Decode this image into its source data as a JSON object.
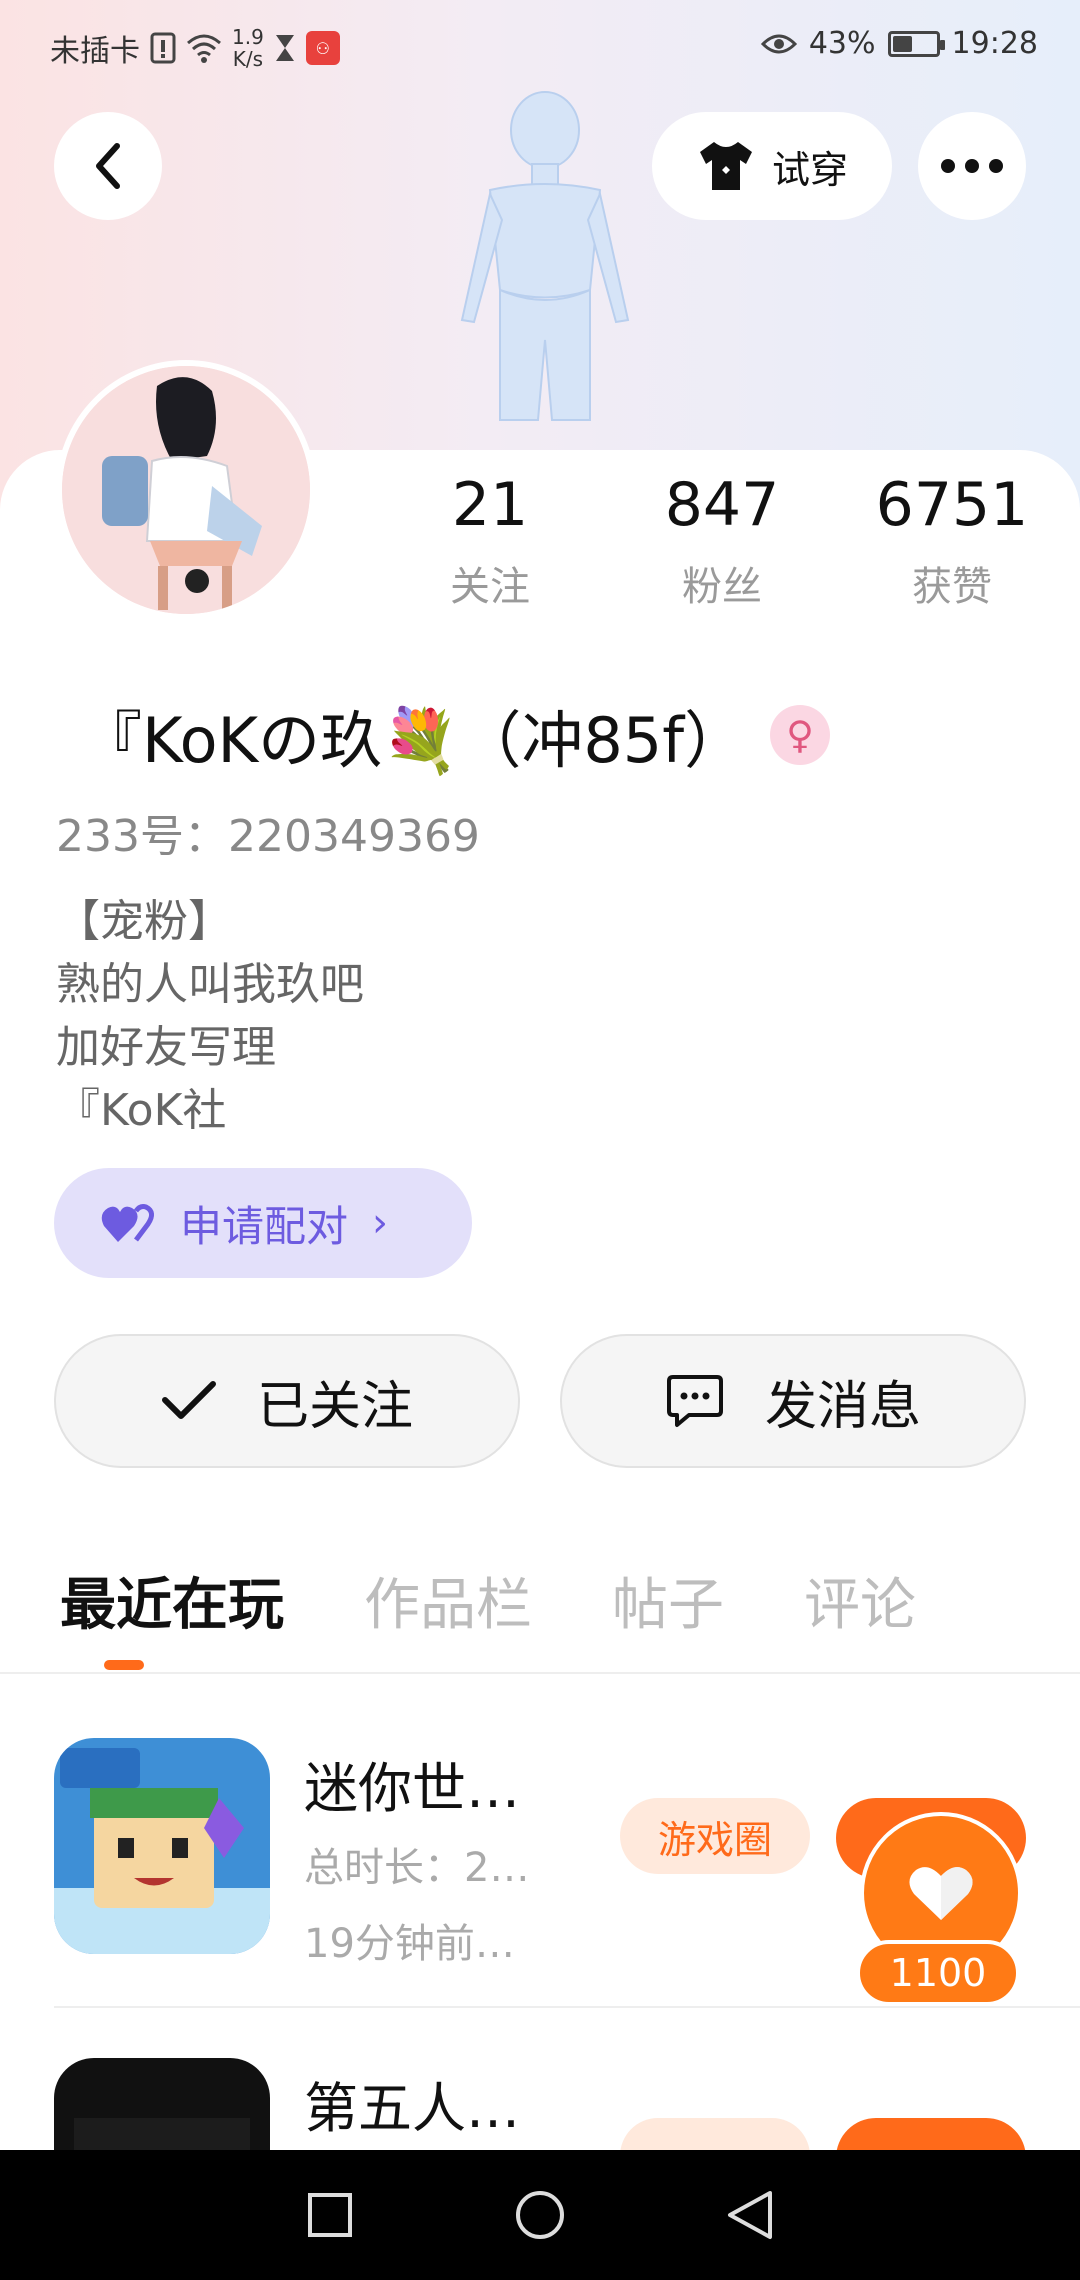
{
  "status_bar": {
    "carrier": "未插卡",
    "speed_value": "1.9",
    "speed_unit": "K/s",
    "battery_percent": "43%",
    "time": "19:28",
    "battery_level": 0.43
  },
  "header": {
    "tryon_label": "试穿"
  },
  "stats": [
    {
      "value": "21",
      "label": "关注"
    },
    {
      "value": "847",
      "label": "粉丝"
    },
    {
      "value": "6751",
      "label": "获赞"
    }
  ],
  "profile": {
    "name": "『KoKの玖💐（冲85f）",
    "gender_symbol": "♀",
    "uid": "233号：220349369",
    "bio": [
      "【宠粉】",
      "熟的人叫我玖吧",
      "加好友写理",
      "『KoK社"
    ]
  },
  "pair_button": {
    "label": "申请配对"
  },
  "actions": {
    "followed_label": "已关注",
    "message_label": "发消息"
  },
  "tabs": [
    {
      "label": "最近在玩",
      "active": true
    },
    {
      "label": "作品栏",
      "active": false
    },
    {
      "label": "帖子",
      "active": false
    },
    {
      "label": "评论",
      "active": false
    }
  ],
  "games": [
    {
      "title": "迷你世…",
      "meta_line1": "总时长：2…",
      "meta_line2": "19分钟前…",
      "circle_label": "游戏圈"
    },
    {
      "title": "第五人…"
    }
  ],
  "like_float": {
    "count": "1100"
  },
  "colors": {
    "accent": "#ff6a1a",
    "pair": "#6d5be0",
    "gender": "#e0577f"
  }
}
